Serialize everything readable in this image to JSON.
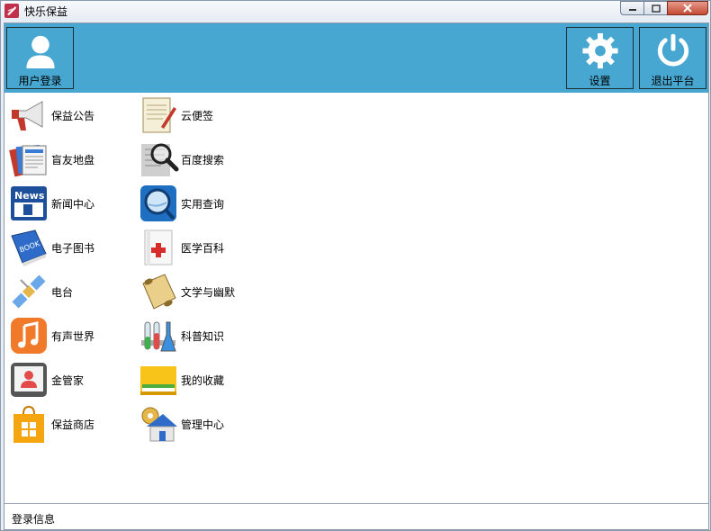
{
  "window": {
    "title": "快乐保益",
    "controls": [
      "minimize",
      "maximize",
      "close"
    ]
  },
  "toolbar": {
    "login_label": "用户登录",
    "settings_label": "设置",
    "exit_label": "退出平台"
  },
  "apps": {
    "left": [
      {
        "label": "保益公告",
        "icon": "megaphone-icon"
      },
      {
        "label": "盲友地盘",
        "icon": "newspapers-icon"
      },
      {
        "label": "新闻中心",
        "icon": "news-icon"
      },
      {
        "label": "电子图书",
        "icon": "book-icon"
      },
      {
        "label": "电台",
        "icon": "satellite-icon"
      },
      {
        "label": "有声世界",
        "icon": "music-icon"
      },
      {
        "label": "金管家",
        "icon": "tablet-user-icon"
      },
      {
        "label": "保益商店",
        "icon": "shopping-bag-icon"
      }
    ],
    "right": [
      {
        "label": "云便签",
        "icon": "notepad-icon"
      },
      {
        "label": "百度搜索",
        "icon": "magnifier-icon"
      },
      {
        "label": "实用查询",
        "icon": "search-globe-icon"
      },
      {
        "label": "医学百科",
        "icon": "medical-book-icon"
      },
      {
        "label": "文学与幽默",
        "icon": "scroll-icon"
      },
      {
        "label": "科普知识",
        "icon": "test-tubes-icon"
      },
      {
        "label": "我的收藏",
        "icon": "folder-icon"
      },
      {
        "label": "管理中心",
        "icon": "house-gear-icon"
      }
    ]
  },
  "status": {
    "text": "登录信息"
  },
  "colors": {
    "toolbar_bg": "#47a7d1",
    "window_frame": "#8a9bb0"
  }
}
